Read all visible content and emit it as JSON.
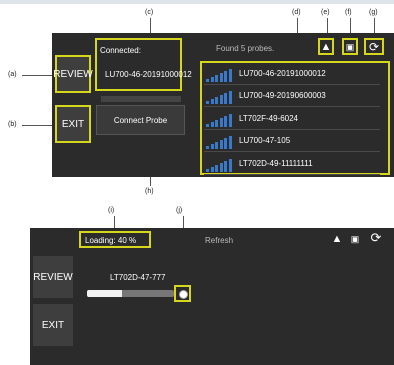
{
  "callouts": {
    "a": "(a)",
    "b": "(b)",
    "c": "(c)",
    "d": "(d)",
    "e": "(e)",
    "f": "(f)",
    "g": "(g)",
    "h": "(h)",
    "i": "(i)",
    "j": "(j)"
  },
  "top_panel": {
    "review_label": "REVIEW",
    "exit_label": "EXIT",
    "connected_title": "Connected:",
    "connected_probe": "LU700-46-20191000012",
    "found_text": "Found 5 probes.",
    "connect_button": "Connect Probe",
    "probes": [
      {
        "name": "LU700-46-20191000012"
      },
      {
        "name": "LU700-49-20190600003"
      },
      {
        "name": "LT702F-49-6024"
      },
      {
        "name": "LU700-47-105"
      },
      {
        "name": "LT702D-49-11111111"
      }
    ],
    "icons": {
      "probe": "probe-icon",
      "fit": "fit-screen-icon",
      "refresh": "refresh-icon"
    }
  },
  "bottom_panel": {
    "loading_text": "Loading: 40 %",
    "loading_progress_percent": 40,
    "refresh_label": "Refresh",
    "review_label": "REVIEW",
    "exit_label": "EXIT",
    "probe_name": "LT702D-47-777"
  },
  "colors": {
    "accent_yellow": "#d6d61a",
    "signal_blue": "#3a78c8",
    "panel_bg": "#2b2b2b"
  }
}
